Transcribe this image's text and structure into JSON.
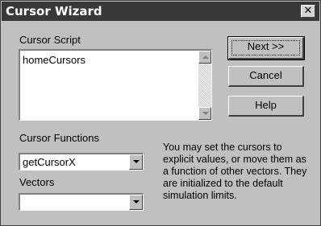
{
  "window": {
    "title": "Cursor Wizard",
    "close_glyph": "✕"
  },
  "script_section": {
    "label": "Cursor Script",
    "text": "homeCursors"
  },
  "buttons": {
    "next": "Next >>",
    "cancel": "Cancel",
    "help": "Help"
  },
  "cursor_functions": {
    "label": "Cursor Functions",
    "selected": "getCursorX"
  },
  "vectors": {
    "label": "Vectors",
    "selected": ""
  },
  "help_text": "You may set the cursors to explicit values, or move them as a function of other vectors. They are initialized to the default simulation limits.",
  "icons": [
    "close-icon",
    "scroll-up-icon",
    "scroll-down-icon",
    "dropdown-arrow-icon"
  ],
  "colors": {
    "titlebar": "#383838",
    "face": "#c0c0c0"
  }
}
